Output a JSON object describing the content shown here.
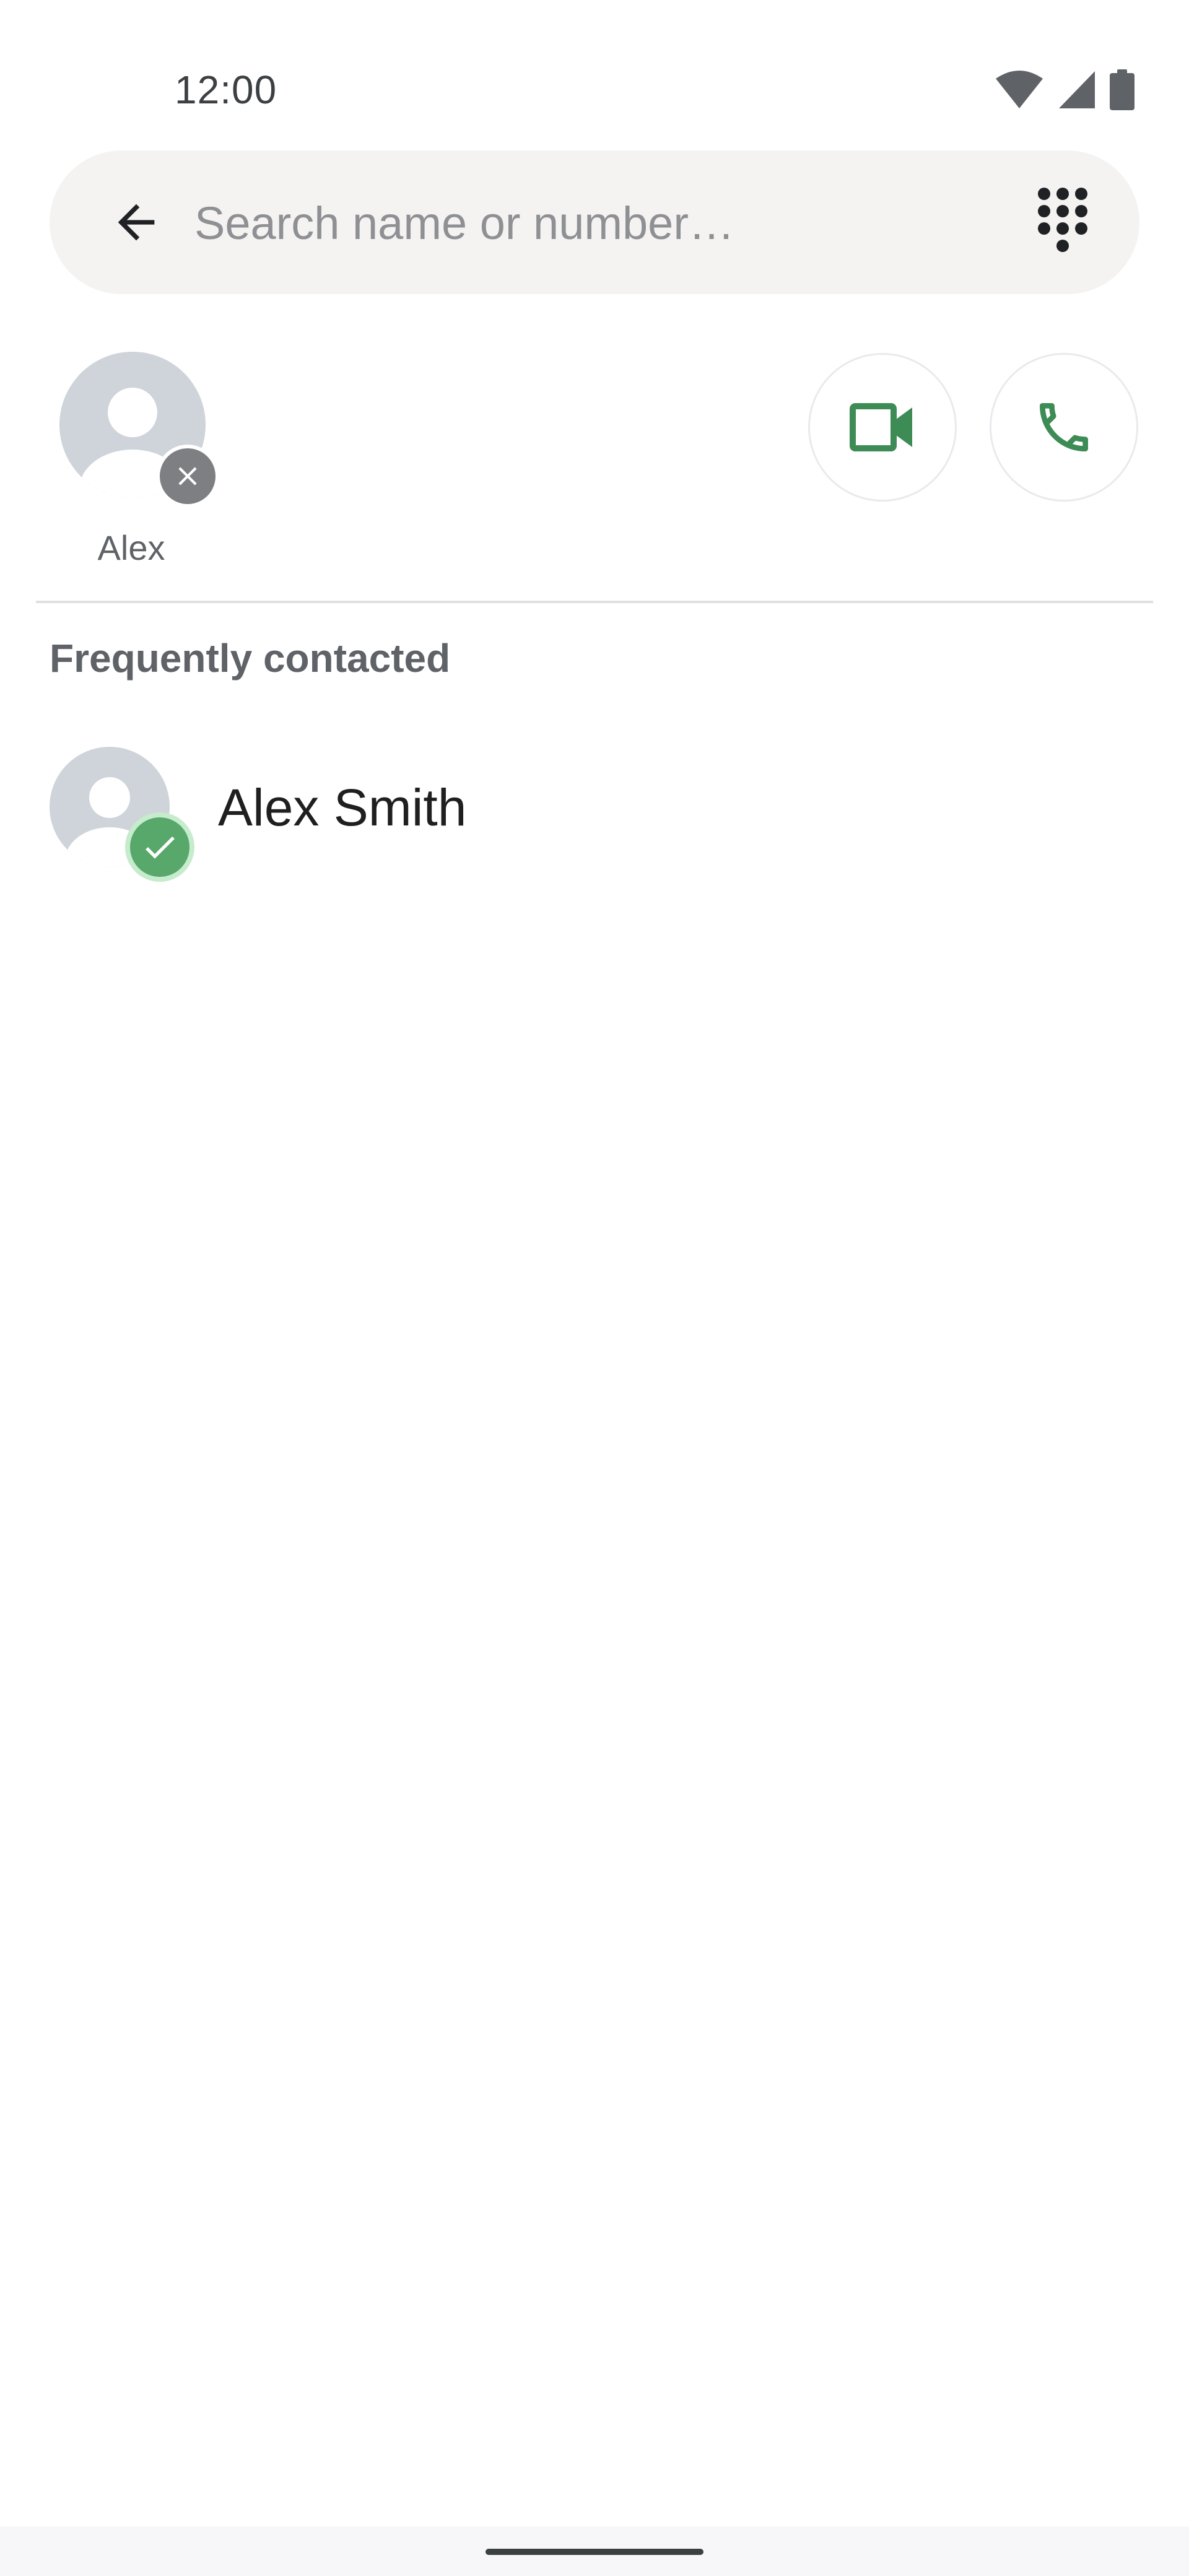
{
  "status_bar": {
    "time": "12:00",
    "icons": [
      "wifi-icon",
      "cell-signal-icon",
      "battery-icon"
    ]
  },
  "search": {
    "placeholder": "Search name or number…",
    "value": ""
  },
  "selected_contact": {
    "label": "Alex",
    "icon": "person-avatar-icon"
  },
  "call_actions": {
    "video_icon": "video-camera-icon",
    "voice_icon": "phone-icon"
  },
  "section": {
    "title": "Frequently contacted"
  },
  "contacts": [
    {
      "name": "Alex Smith",
      "selected": true
    }
  ],
  "colors": {
    "accent_green": "#3d8b55",
    "check_green": "#57a86a",
    "search_bg": "#f4f3f1",
    "avatar_bg": "#cfd4da"
  }
}
